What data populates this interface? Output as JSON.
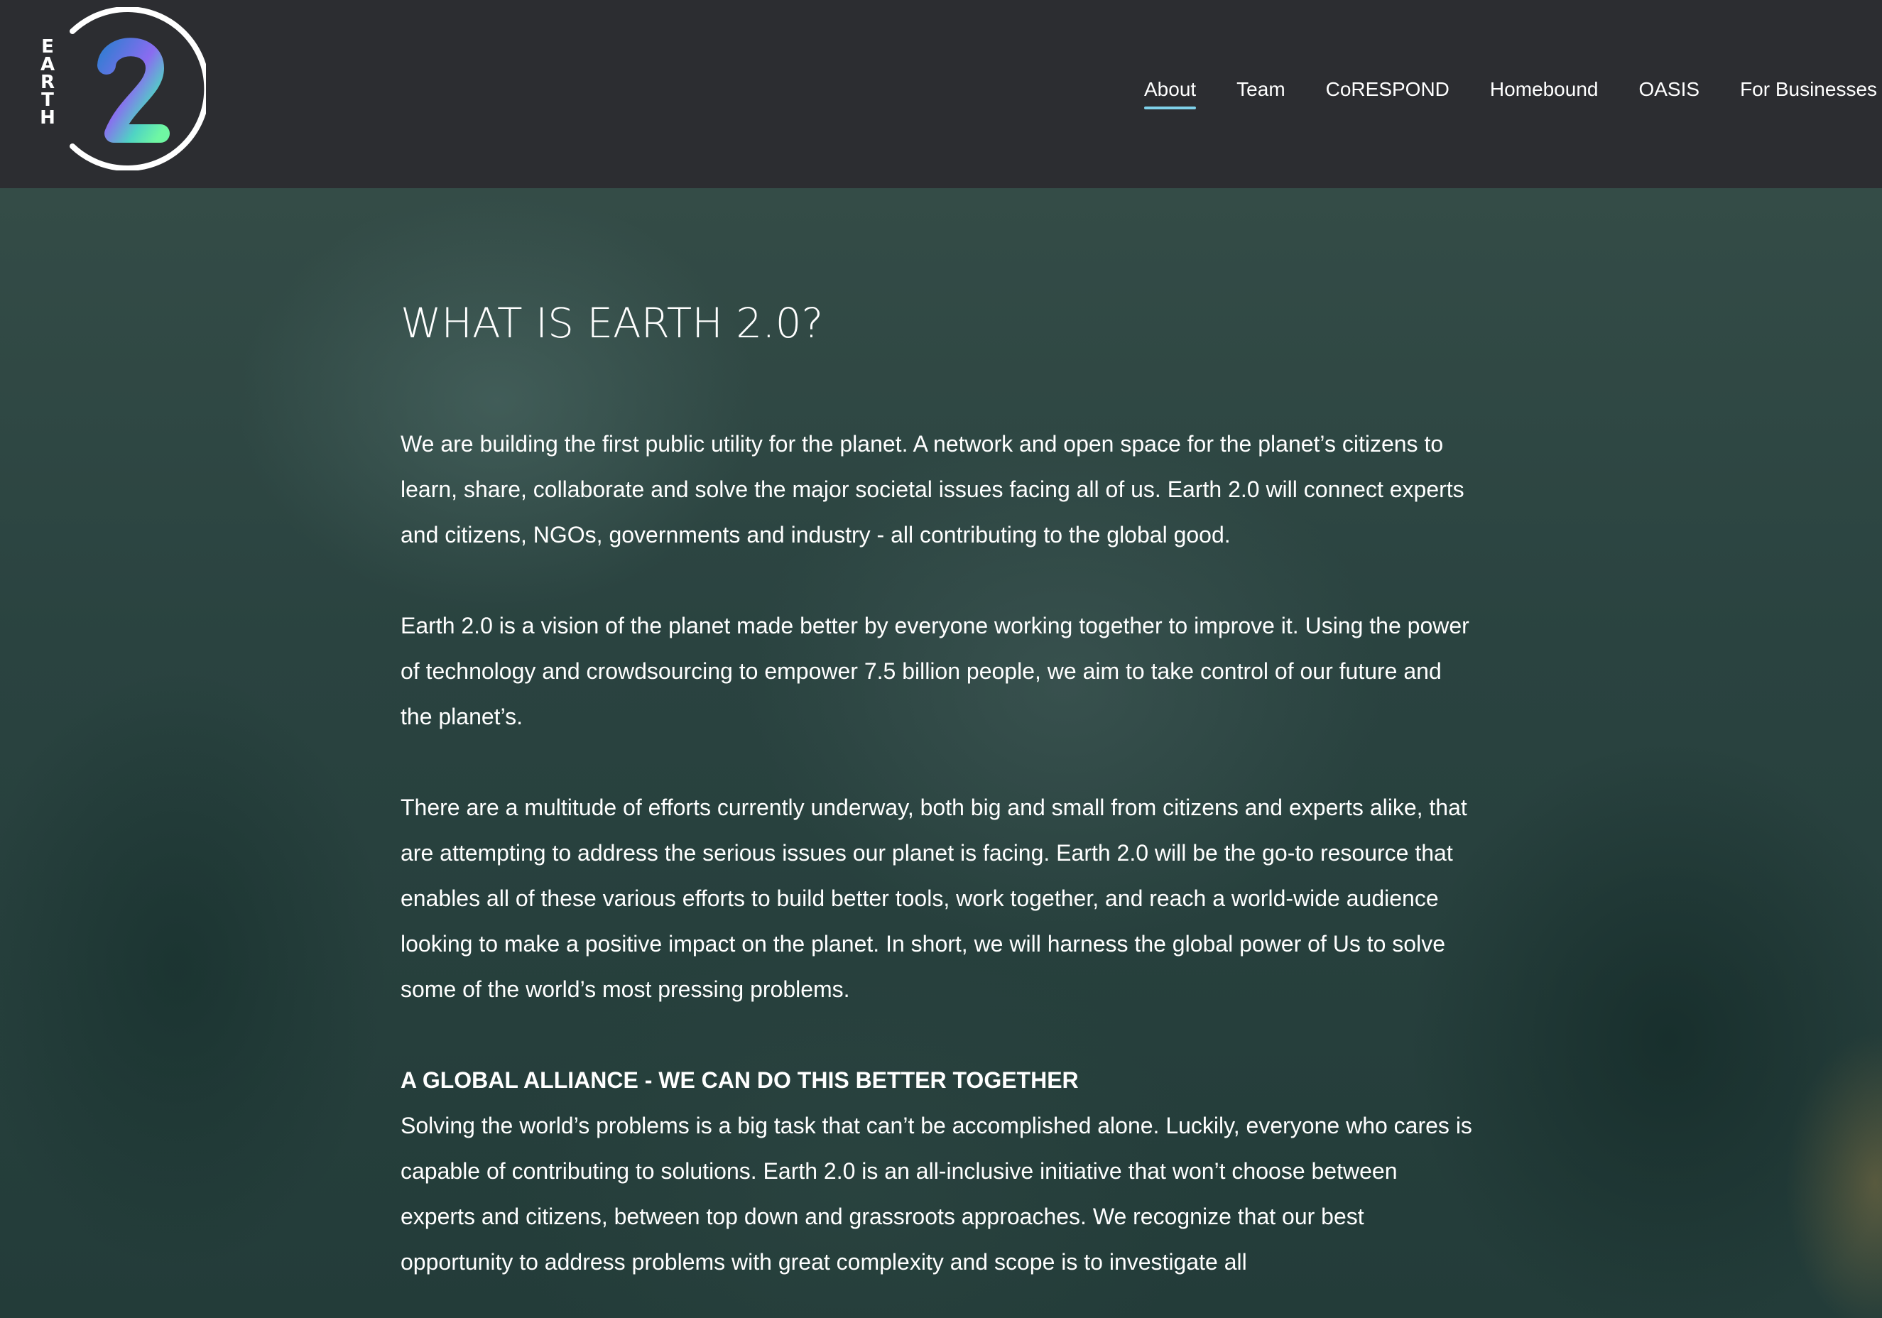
{
  "header": {
    "logo_letters": [
      "E",
      "A",
      "R",
      "T",
      "H"
    ],
    "logo_number": "2",
    "nav": [
      {
        "label": "About",
        "active": true
      },
      {
        "label": "Team",
        "active": false
      },
      {
        "label": "CoRESPOND",
        "active": false
      },
      {
        "label": "Homebound",
        "active": false
      },
      {
        "label": "OASIS",
        "active": false
      },
      {
        "label": "For Businesses",
        "active": false
      }
    ],
    "accent_color": "#7fd1ea"
  },
  "main": {
    "title": "WHAT IS EARTH 2.0?",
    "paragraphs": [
      "We are building the first public utility for the planet. A network and open space for the planet’s citizens to learn, share, collaborate and solve the major societal issues facing all of us. Earth 2.0 will connect experts and citizens, NGOs, governments and industry - all contributing to the global good.",
      "Earth 2.0 is a vision of the planet made better by everyone working together to improve it. Using the power of technology and crowdsourcing to empower 7.5 billion people, we aim to take control of our future and the planet’s.",
      "There are a multitude of efforts currently underway, both big and small from citizens and experts alike, that are attempting to address the serious issues our planet is facing. Earth 2.0 will be the go-to resource that enables all of these various efforts to build better tools, work together, and reach a world-wide audience looking to make a positive impact on the planet. In short, we will harness the global power of Us to solve some of the world’s most pressing problems."
    ],
    "subheading": "A GLOBAL ALLIANCE - WE CAN DO THIS BETTER TOGETHER",
    "subparagraph": "Solving the world’s problems is a big task that can’t be accomplished alone. Luckily, everyone who cares is capable of contributing to solutions. Earth 2.0 is an all-inclusive initiative that won’t choose between experts and citizens, between top down and grassroots approaches. We recognize that our best opportunity to address problems with great complexity and scope is to investigate all"
  }
}
